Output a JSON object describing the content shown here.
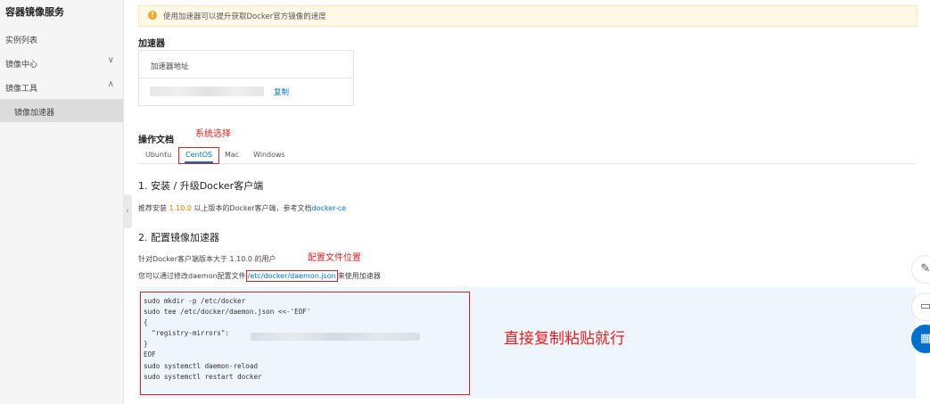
{
  "sidebar": {
    "title": "容器镜像服务",
    "items": [
      {
        "label": "实例列表",
        "chevron": ""
      },
      {
        "label": "镜像中心",
        "chevron": "∨"
      },
      {
        "label": "镜像工具",
        "chevron": "∧"
      },
      {
        "label": "镜像加速器",
        "chevron": ""
      }
    ],
    "collapse_glyph": "‹"
  },
  "notice": {
    "icon": "!",
    "text": "使用加速器可以提升获取Docker官方镜像的速度"
  },
  "accelerator": {
    "heading": "加速器",
    "address_label": "加速器地址",
    "copy_label": "复制"
  },
  "docs": {
    "heading": "操作文档",
    "tabs": [
      "Ubuntu",
      "CentOS",
      "Mac",
      "Windows"
    ],
    "active_tab": "CentOS",
    "step1": {
      "title": "1. 安装 / 升级Docker客户端",
      "text_before": "推荐安装 ",
      "version": "1.10.0",
      "text_middle": " 以上版本的Docker客户端，参考文档",
      "link": "docker-ce"
    },
    "step2": {
      "title": "2. 配置镜像加速器",
      "line1": "针对Docker客户端版本大于 1.10.0 的用户",
      "line2_before": "您可以通过修改daemon配置文件",
      "path": "/etc/docker/daemon.json",
      "line2_after": "来使用加速器"
    },
    "code_lines": [
      "sudo mkdir -p /etc/docker",
      "sudo tee /etc/docker/daemon.json <<-'EOF'",
      "{",
      "  \"registry-mirrors\":",
      "}",
      "EOF",
      "sudo systemctl daemon-reload",
      "sudo systemctl restart docker"
    ]
  },
  "annotations": {
    "system_select": "系统选择",
    "config_location": "配置文件位置",
    "copy_paste": "直接复制粘贴就行"
  },
  "floating": {
    "edit_glyph": "✎",
    "feedback_glyph": "▭",
    "apps_glyph": "▦"
  },
  "colors": {
    "accent": "#0070cc",
    "annotation": "#e02020",
    "notice_bg": "#fff8e6",
    "code_bg": "#eef5fc"
  }
}
